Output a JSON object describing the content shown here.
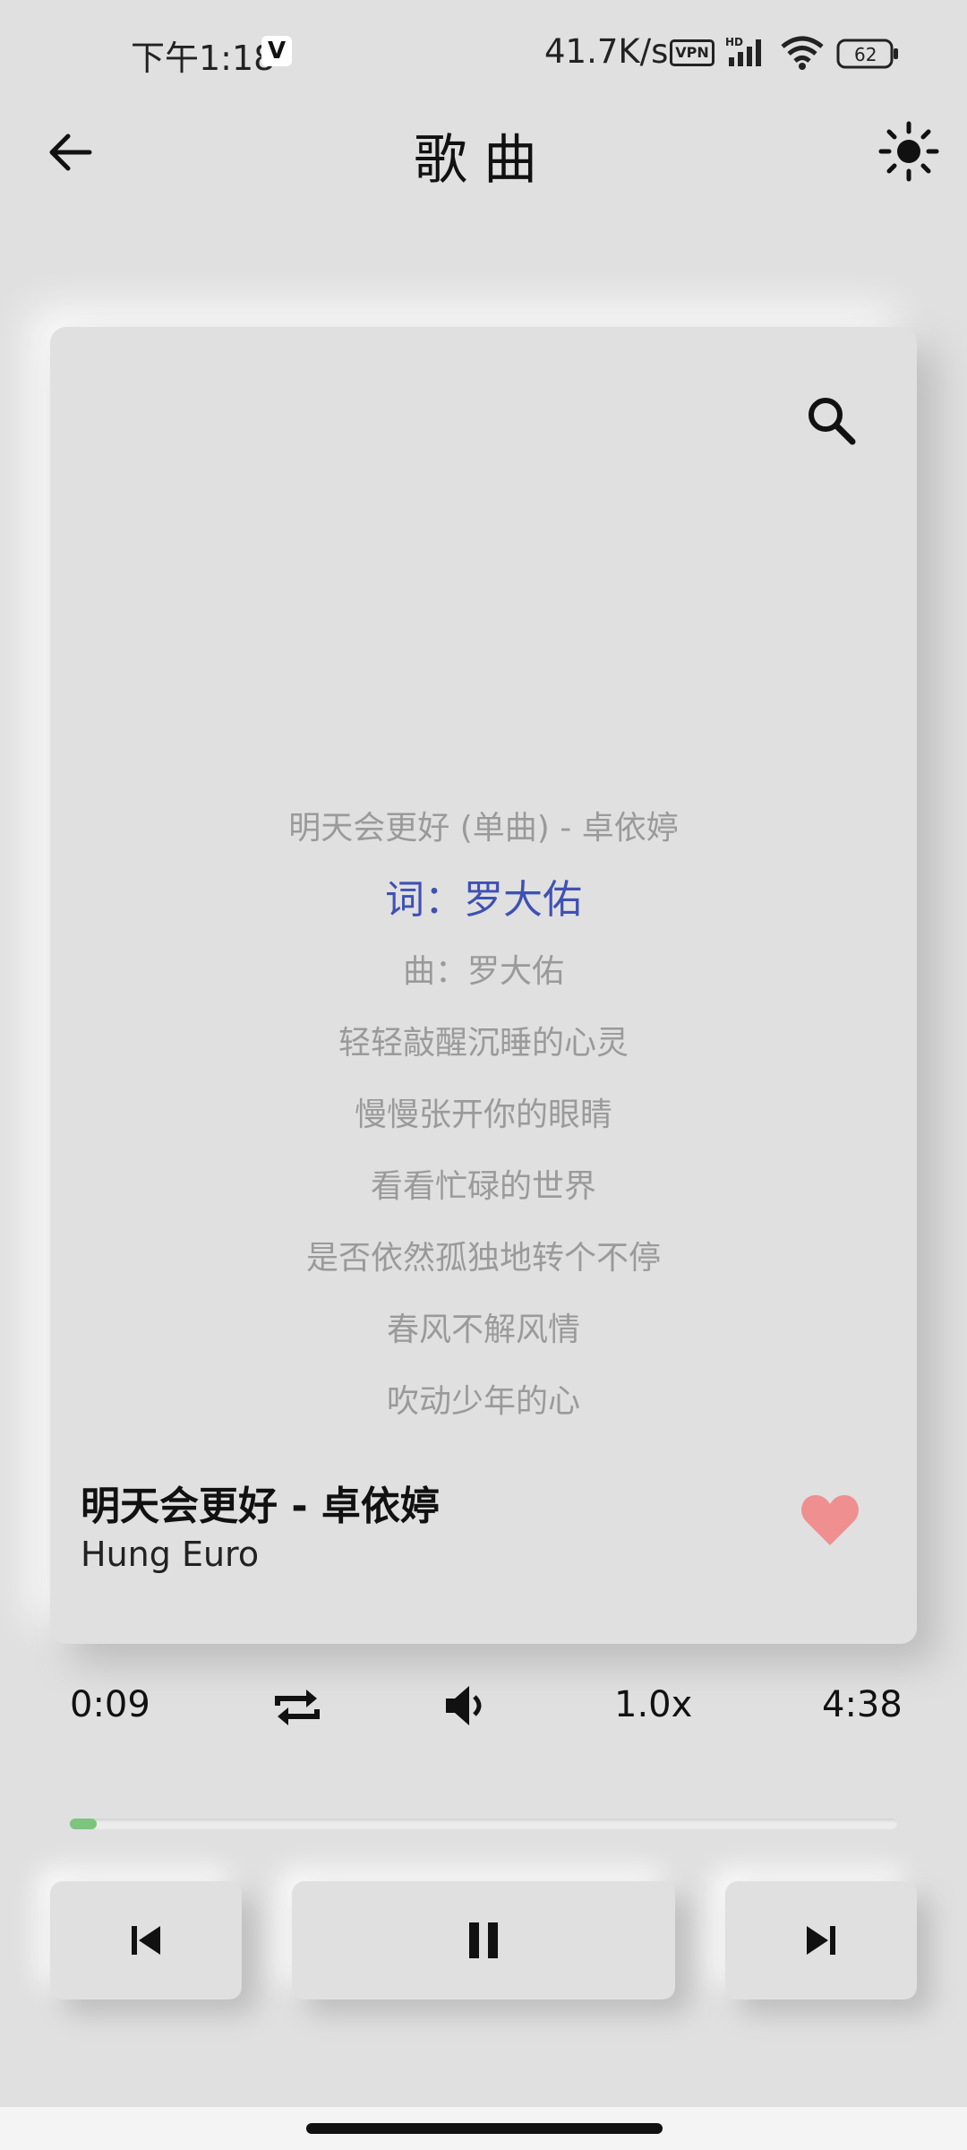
{
  "status_bar": {
    "time": "下午1:18",
    "app_badge": "V",
    "net_speed": "41.7K/s",
    "vpn": "VPN",
    "signal_tag": "HD",
    "battery": "62"
  },
  "header": {
    "title": "歌曲"
  },
  "lyrics": [
    {
      "text": "明天会更好 (单曲) - 卓依婷",
      "active": false
    },
    {
      "text": "词：罗大佑",
      "active": true
    },
    {
      "text": "曲：罗大佑",
      "active": false
    },
    {
      "text": "轻轻敲醒沉睡的心灵",
      "active": false
    },
    {
      "text": "慢慢张开你的眼睛",
      "active": false
    },
    {
      "text": "看看忙碌的世界",
      "active": false
    },
    {
      "text": "是否依然孤独地转个不停",
      "active": false
    },
    {
      "text": "春风不解风情",
      "active": false
    },
    {
      "text": "吹动少年的心",
      "active": false
    }
  ],
  "track": {
    "title": "明天会更好 - 卓依婷",
    "artist": "Hung Euro",
    "liked": true
  },
  "playback": {
    "current_time": "0:09",
    "total_time": "4:38",
    "speed": "1.0x",
    "progress_fraction": 0.032
  },
  "colors": {
    "background": "#e0e0e0",
    "accent_lyric": "#3f51b5",
    "like": "#ef8f8f",
    "progress": "#7cc47f"
  },
  "icons": {
    "back": "arrow-left-icon",
    "theme": "sun-icon",
    "search": "search-icon",
    "like": "heart-icon",
    "repeat": "repeat-icon",
    "volume": "volume-icon",
    "prev": "skip-previous-icon",
    "play": "pause-icon",
    "next": "skip-next-icon"
  }
}
